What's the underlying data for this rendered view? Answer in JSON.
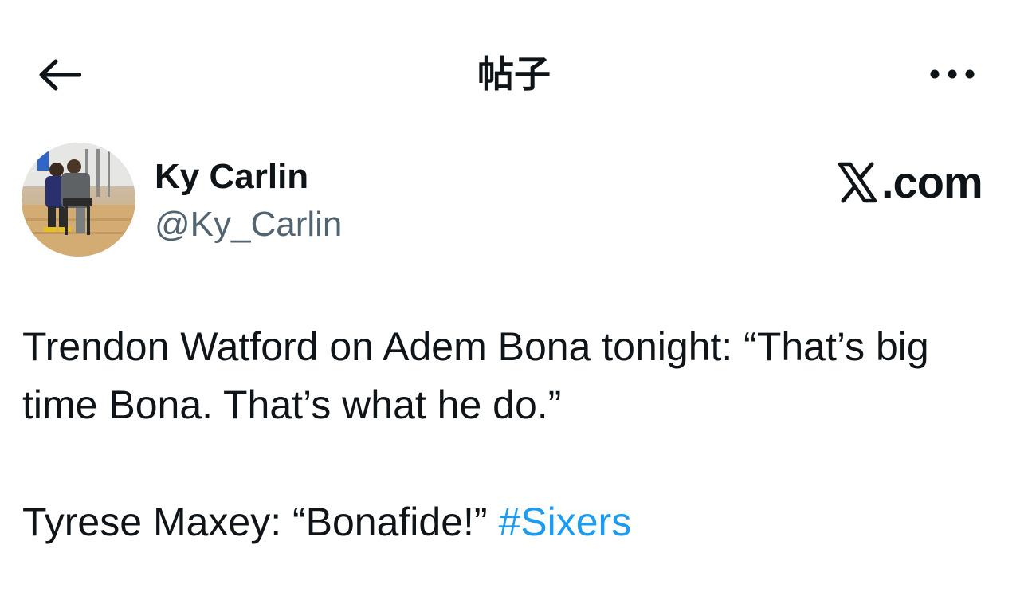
{
  "header": {
    "title": "帖子",
    "back_icon": "arrow-left-icon",
    "more_icon": "more-horizontal-icon"
  },
  "author": {
    "name": "Ky Carlin",
    "handle": "@Ky_Carlin",
    "avatar_icon": "profile-photo"
  },
  "brand": {
    "mark": "X",
    "text": ".com"
  },
  "post": {
    "line1": "Trendon Watford on Adem Bona tonight: “That’s big time Bona. That’s what he do.”",
    "line2": "Tyrese Maxey: “Bonafide!”",
    "hashtag": "#Sixers"
  },
  "colors": {
    "text": "#0f1419",
    "secondary": "#536471",
    "link": "#1d9bf0",
    "background": "#ffffff"
  }
}
